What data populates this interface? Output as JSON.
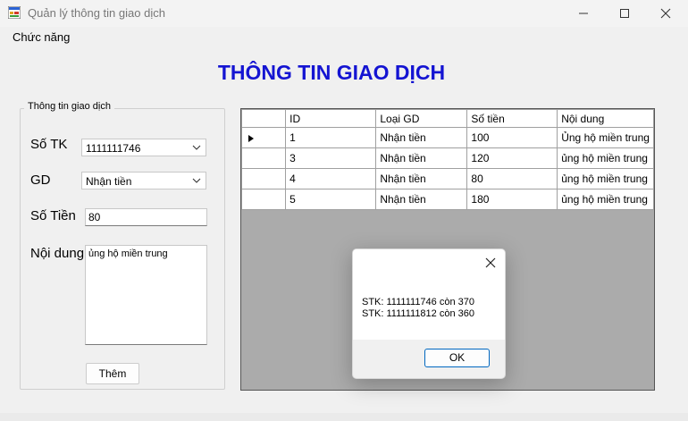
{
  "window": {
    "title": "Quản lý thông tin giao dịch",
    "menu": [
      "Chức năng"
    ]
  },
  "heading": "THÔNG TIN GIAO DỊCH",
  "form": {
    "group_title": "Thông tin giao dịch",
    "stk_label": "Số TK",
    "stk_value": "1111111746",
    "gd_label": "GD",
    "gd_value": "Nhận tiền",
    "sotien_label": "Số Tiền",
    "sotien_value": "80",
    "noidung_label": "Nội dung",
    "noidung_value": "ủng hộ miền trung",
    "add_button": "Thêm"
  },
  "table": {
    "columns": [
      "ID",
      "Loại GD",
      "Số tiền",
      "Nội dung"
    ],
    "rows": [
      [
        "1",
        "Nhận tiền",
        "100",
        "Ủng hộ miền trung"
      ],
      [
        "3",
        "Nhận tiền",
        "120",
        "ủng hộ miền trung"
      ],
      [
        "4",
        "Nhận tiền",
        "80",
        "ủng hộ miền trung"
      ],
      [
        "5",
        "Nhận tiền",
        "180",
        "ủng hộ miền trung"
      ]
    ]
  },
  "dialog": {
    "lines": [
      "STK: 1111111746 còn 370",
      "STK: 1111111812 còn 360"
    ],
    "ok": "OK"
  },
  "icons": {
    "app": "app-icon",
    "minimize": "minimize-icon",
    "maximize": "maximize-icon",
    "close": "close-icon",
    "chevron": "chevron-down-icon",
    "row_pointer": "current-row-arrow-icon"
  },
  "colors": {
    "heading": "#1414d2",
    "grid_background": "#ababab",
    "ok_border": "#0067c0"
  }
}
